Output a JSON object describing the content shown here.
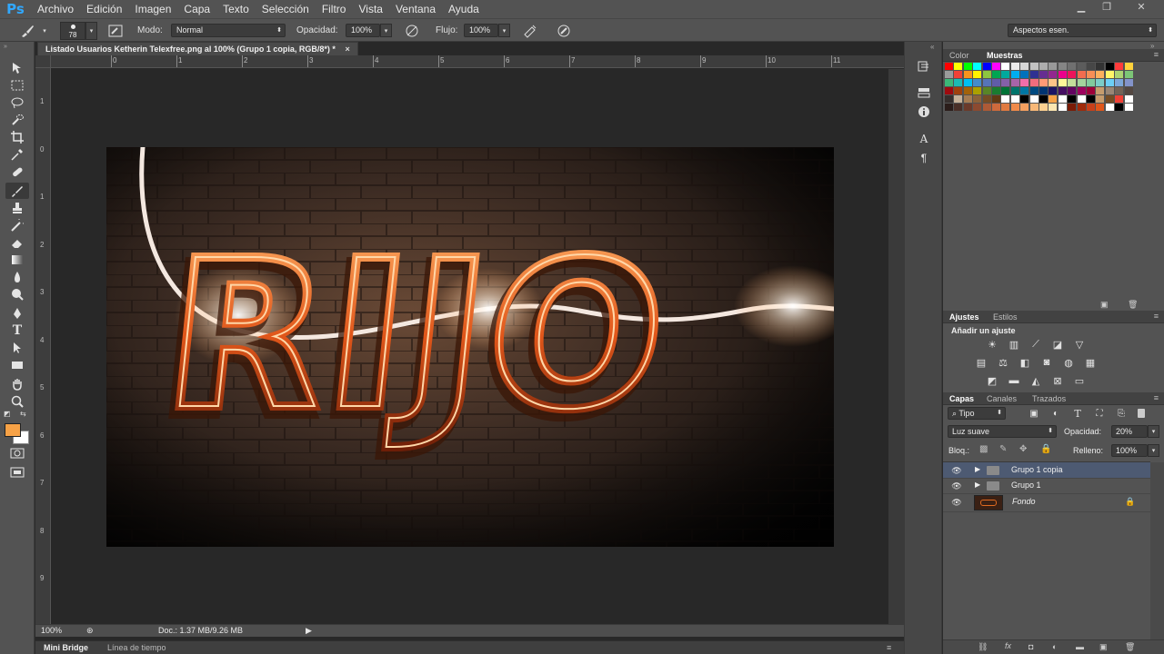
{
  "app": {
    "logo": "Ps"
  },
  "menu": [
    "Archivo",
    "Edición",
    "Imagen",
    "Capa",
    "Texto",
    "Selección",
    "Filtro",
    "Vista",
    "Ventana",
    "Ayuda"
  ],
  "options": {
    "brush_size": "78",
    "mode_label": "Modo:",
    "mode_value": "Normal",
    "opacity_label": "Opacidad:",
    "opacity_value": "100%",
    "flow_label": "Flujo:",
    "flow_value": "100%",
    "workspace": "Aspectos esen."
  },
  "document": {
    "tab_title": "Listado Usuarios Ketherin Telexfree.png al 100% (Grupo 1 copia, RGB/8*) *",
    "zoom": "100%",
    "doc_info": "Doc.: 1.37 MB/9.26 MB",
    "ruler_top": [
      "0",
      "1",
      "2",
      "3",
      "4",
      "5",
      "6",
      "7",
      "8",
      "9",
      "10",
      "11"
    ],
    "ruler_left": [
      "1",
      "0",
      "1",
      "2",
      "3",
      "4",
      "5",
      "6",
      "7",
      "8",
      "9"
    ],
    "artwork_text": "RIJO"
  },
  "bottom_tabs": [
    "Mini Bridge",
    "Línea de tiempo"
  ],
  "swatches_panel": {
    "tabs": [
      "Color",
      "Muestras"
    ]
  },
  "adjustments_panel": {
    "tabs": [
      "Ajustes",
      "Estilos"
    ],
    "heading": "Añadir un ajuste"
  },
  "layers_panel": {
    "tabs": [
      "Capas",
      "Canales",
      "Trazados"
    ],
    "filter": "Tipo",
    "blend_mode": "Luz suave",
    "opacity_label": "Opacidad:",
    "opacity_value": "20%",
    "lock_label": "Bloq.:",
    "fill_label": "Relleno:",
    "fill_value": "100%",
    "layers": [
      {
        "name": "Grupo 1 copia",
        "type": "group",
        "selected": true
      },
      {
        "name": "Grupo 1",
        "type": "group",
        "selected": false
      },
      {
        "name": "Fondo",
        "type": "background",
        "selected": false
      }
    ]
  },
  "colors": {
    "accent_fg": "#f7a246",
    "selection": "#4d5a72"
  }
}
